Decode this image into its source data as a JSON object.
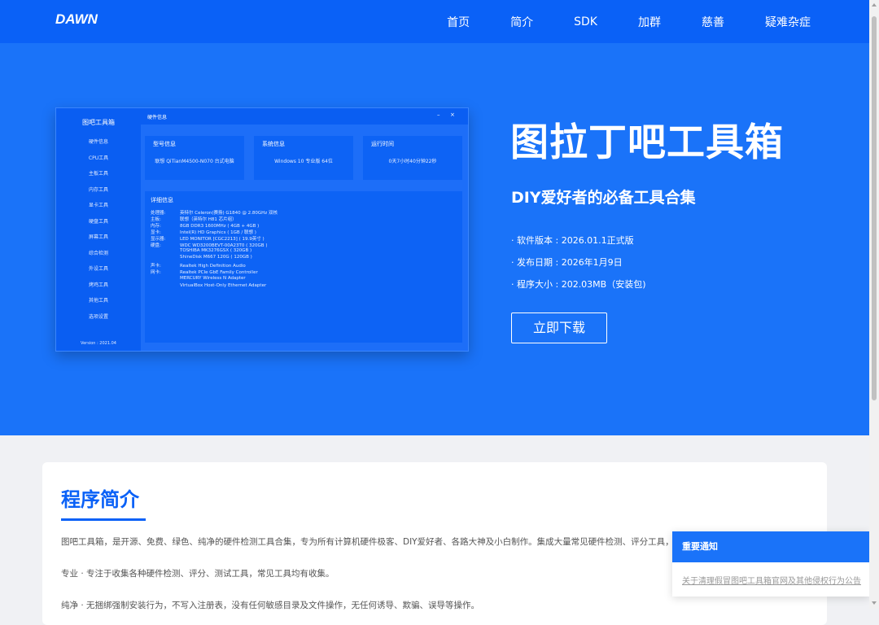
{
  "nav": {
    "logo": "DAWN",
    "links": [
      "首页",
      "简介",
      "SDK",
      "加群",
      "慈善",
      "疑难杂症"
    ]
  },
  "hero": {
    "title": "图拉丁吧工具箱",
    "subtitle": "DIY爱好者的必备工具合集",
    "version": "· 软件版本 : 2026.01.1正式版",
    "date": "· 发布日期 : 2026年1月9日",
    "size": "· 程序大小 : 202.03MB（安装包)",
    "download": "立即下载"
  },
  "mockup": {
    "app_title": "图吧工具箱",
    "window_title": "硬件信息",
    "min_icon": "–",
    "close_icon": "×",
    "sidebar": [
      "硬件信息",
      "CPU工具",
      "主板工具",
      "内存工具",
      "显卡工具",
      "硬盘工具",
      "屏幕工具",
      "综合检测",
      "外设工具",
      "烤鸡工具",
      "其他工具",
      "选项设置"
    ],
    "version": "Version : 2021.04",
    "cards": [
      {
        "title": "型号信息",
        "value": "联想 QiTianM4500-N070 台式电脑"
      },
      {
        "title": "系统信息",
        "value": "Windows 10 专业版 64位"
      },
      {
        "title": "运行时间",
        "value": "0天7小时40分钟22秒"
      }
    ],
    "detail_title": "详细信息",
    "details": [
      {
        "k": "处理器:",
        "v": "英特尔 Celeron(赛扬) G1840 @ 2.80GHz 双核"
      },
      {
        "k": "主板:",
        "v": "联想（英特尔 H81 芯片组）"
      },
      {
        "k": "内存:",
        "v": "8GB DDR3 1600MHz ( 4GB + 4GB )"
      },
      {
        "k": "显卡:",
        "v": "Intel(R) HD Graphics ( 1GB / 联想 )"
      },
      {
        "k": "显示器:",
        "v": "LED MONITOR [CGC2213] ( 19.9英寸 )"
      },
      {
        "k": "硬盘:",
        "v": "WDC WD3200BEVT-00A23T0 ( 320GB )"
      },
      {
        "k": "",
        "v": "TOSHIBA MK3276GSX ( 320GB )"
      },
      {
        "k": "",
        "v": "ShineDisk M667 120G ( 120GB )"
      },
      {
        "k": "声卡:",
        "v": "Realtek High Definition Audio"
      },
      {
        "k": "网卡:",
        "v": "Realtek PCIe GbE Family Controller"
      },
      {
        "k": "",
        "v": "MERCURY Wireless N Adapter"
      },
      {
        "k": "",
        "v": "VirtualBox Host-Only Ethernet Adapter"
      }
    ]
  },
  "intro": {
    "title": "程序简介",
    "p1": "图吧工具箱，是开源、免费、绿色、纯净的硬件检测工具合集，专为所有计算机硬件极客、DIY爱好者、各路大神及小白制作。集成大量常见硬件检测、评分工具，一键下载、方便使用。",
    "p2": "专业 · 专注于收集各种硬件检测、评分、测试工具，常见工具均有收集。",
    "p3": "纯净 · 无捆绑强制安装行为，不写入注册表，没有任何敏感目录及文件操作，无任何诱导、欺骗、误导等操作。"
  },
  "notice": {
    "header": "重要通知",
    "link": "关于清理假冒图吧工具箱官网及其他侵权行为公告"
  },
  "colors": {
    "brand": "#0a61f7",
    "hero": "#1a73f9"
  }
}
